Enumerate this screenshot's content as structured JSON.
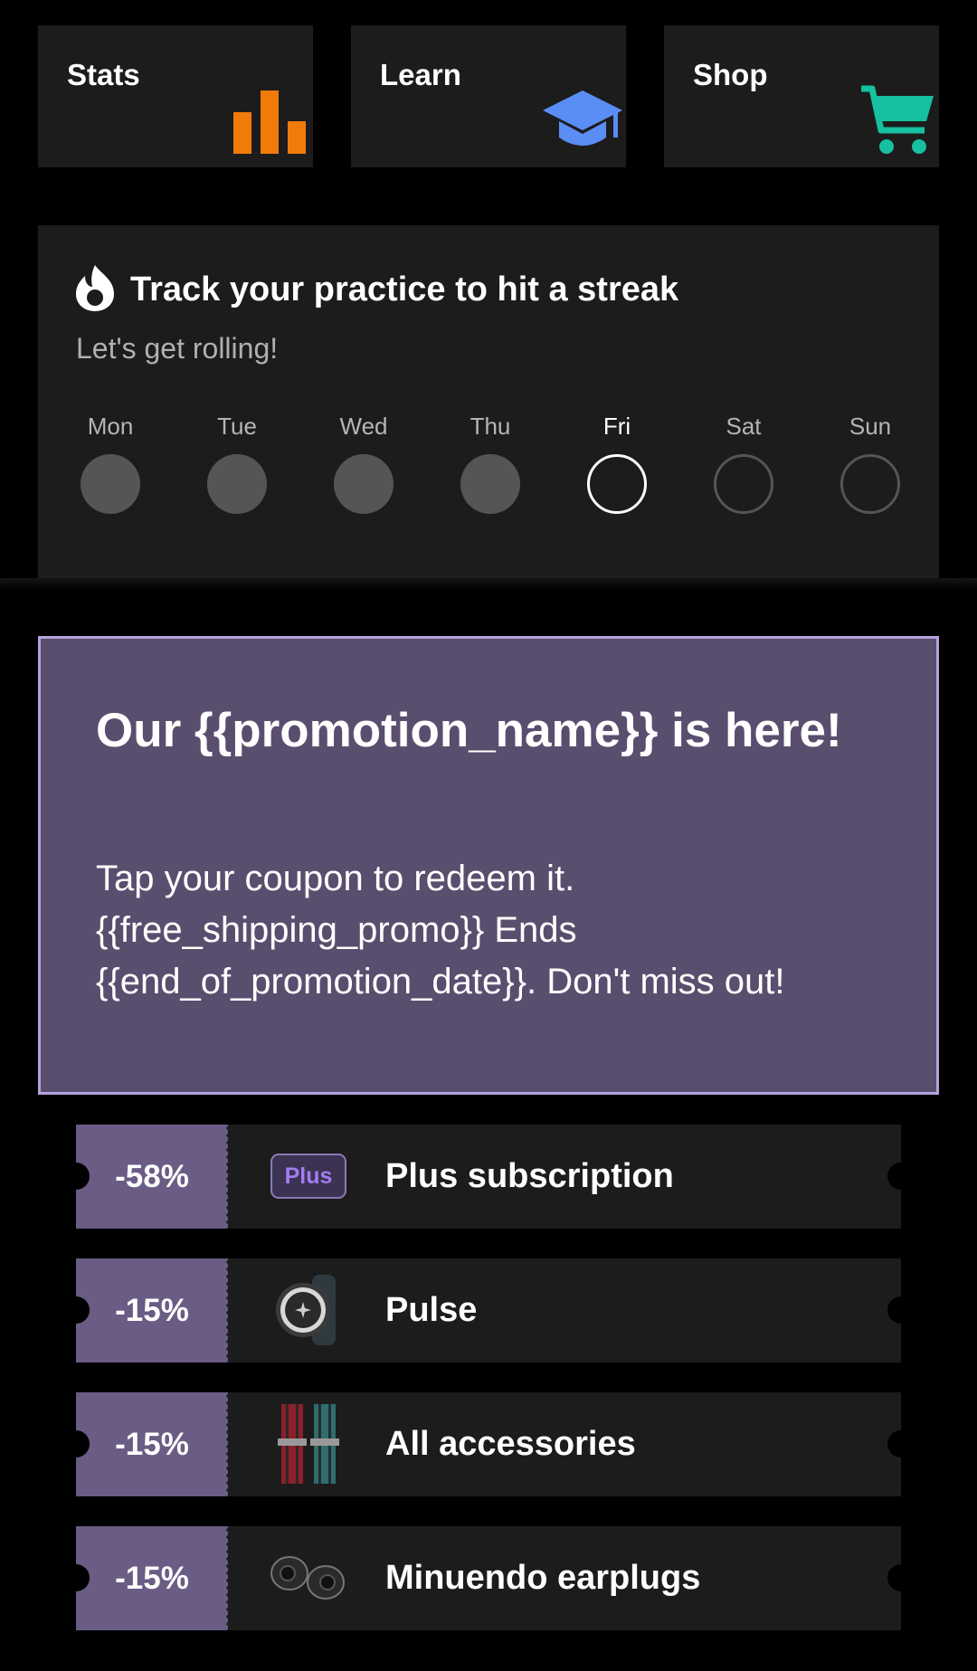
{
  "tiles": [
    {
      "label": "Stats",
      "icon": "bar-chart-icon",
      "color": "#f07a0a"
    },
    {
      "label": "Learn",
      "icon": "graduation-cap-icon",
      "color": "#5b8ef5"
    },
    {
      "label": "Shop",
      "icon": "shopping-cart-icon",
      "color": "#16c0a0"
    }
  ],
  "streak": {
    "icon": "flame-icon",
    "title": "Track your practice to hit a streak",
    "subtitle": "Let's get rolling!",
    "days": [
      {
        "label": "Mon",
        "state": "done"
      },
      {
        "label": "Tue",
        "state": "done"
      },
      {
        "label": "Wed",
        "state": "done"
      },
      {
        "label": "Thu",
        "state": "done"
      },
      {
        "label": "Fri",
        "state": "current"
      },
      {
        "label": "Sat",
        "state": "future"
      },
      {
        "label": "Sun",
        "state": "future"
      }
    ]
  },
  "promo": {
    "title": "Our {{promotion_name}} is here!",
    "body": "Tap your coupon to redeem it. {{free_shipping_promo}} Ends {{end_of_promotion_date}}. Don't miss out!"
  },
  "coupons": [
    {
      "discount": "-58%",
      "label": "Plus subscription",
      "thumb": "plus-badge",
      "thumb_text": "Plus"
    },
    {
      "discount": "-15%",
      "label": "Pulse",
      "thumb": "pulse-watch-image"
    },
    {
      "discount": "-15%",
      "label": "All accessories",
      "thumb": "straps-image"
    },
    {
      "discount": "-15%",
      "label": "Minuendo earplugs",
      "thumb": "earplugs-image"
    }
  ],
  "colors": {
    "promo_bg": "#5a4e6e",
    "promo_border": "#b4a3dc",
    "coupon_badge": "#6a5c84",
    "card_bg": "#1c1c1c"
  }
}
